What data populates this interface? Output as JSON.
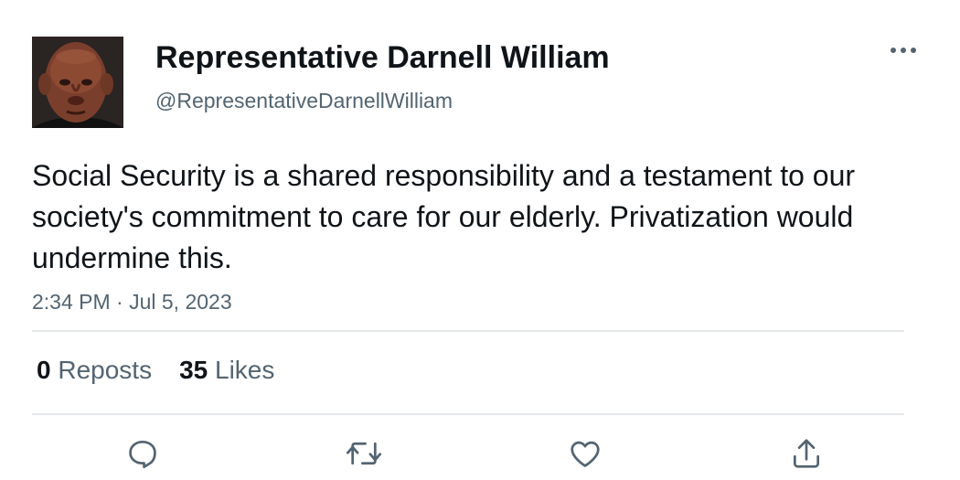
{
  "author": {
    "display_name": "Representative Darnell William",
    "handle": "@RepresentativeDarnellWilliam",
    "avatar_icon": "profile-photo"
  },
  "tweet": {
    "text": "Social Security is a shared responsibility and a testament to our society's commitment to care for our elderly. Privatization would undermine this.",
    "timestamp": "2:34 PM · Jul 5, 2023"
  },
  "stats": {
    "reposts_count": "0",
    "reposts_label": "Reposts",
    "likes_count": "35",
    "likes_label": "Likes"
  },
  "actions": [
    {
      "name": "reply",
      "icon": "speech-bubble-icon"
    },
    {
      "name": "repost",
      "icon": "repost-arrows-icon"
    },
    {
      "name": "like",
      "icon": "heart-icon"
    },
    {
      "name": "share",
      "icon": "share-upload-icon"
    }
  ],
  "menu": {
    "icon": "more-dots-icon"
  },
  "colors": {
    "text_primary": "#0f1419",
    "text_secondary": "#536471",
    "divider": "#e4e7ea"
  }
}
